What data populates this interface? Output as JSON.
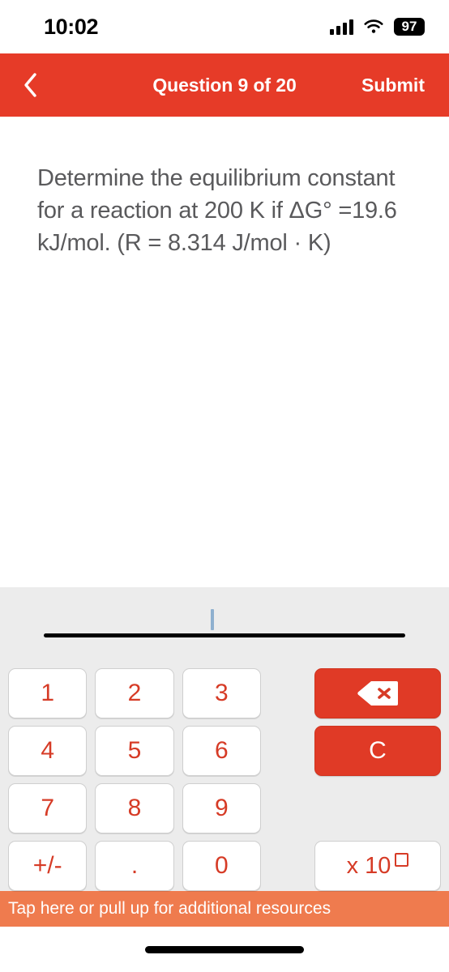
{
  "status_bar": {
    "time": "10:02",
    "battery": "97",
    "signal_icon": "cellular-signal-icon",
    "wifi_icon": "wifi-icon"
  },
  "header": {
    "back_icon": "chevron-left-icon",
    "title": "Question 9 of 20",
    "submit_label": "Submit",
    "background_color": "#E63B28"
  },
  "question": {
    "text": "Determine the equilibrium constant for a reaction at 200 K if ΔG° =19.6 kJ/mol. (R = 8.314 J/mol · K)",
    "text_color": "#5a5a5c"
  },
  "answer_input": {
    "value": "",
    "caret_visible": true,
    "caret_color": "#8FB0CF",
    "rule_color": "#000000"
  },
  "keypad": {
    "background_color": "#ECECEC",
    "key_text_color": "#D63B26",
    "accent_color": "#E03A26",
    "number_keys": [
      {
        "label": "1",
        "name": "key-1"
      },
      {
        "label": "2",
        "name": "key-2"
      },
      {
        "label": "3",
        "name": "key-3"
      },
      {
        "label": "4",
        "name": "key-4"
      },
      {
        "label": "5",
        "name": "key-5"
      },
      {
        "label": "6",
        "name": "key-6"
      },
      {
        "label": "7",
        "name": "key-7"
      },
      {
        "label": "8",
        "name": "key-8"
      },
      {
        "label": "9",
        "name": "key-9"
      },
      {
        "label": "+/-",
        "name": "key-sign"
      },
      {
        "label": ".",
        "name": "key-decimal"
      },
      {
        "label": "0",
        "name": "key-0"
      }
    ],
    "backspace_icon": "backspace-delete-icon",
    "clear_label": "C",
    "scientific_label": "x 10",
    "scientific_exponent_placeholder": ""
  },
  "resources_bar": {
    "label": "Tap here or pull up for additional resources",
    "background_color": "#EF7B4E"
  }
}
